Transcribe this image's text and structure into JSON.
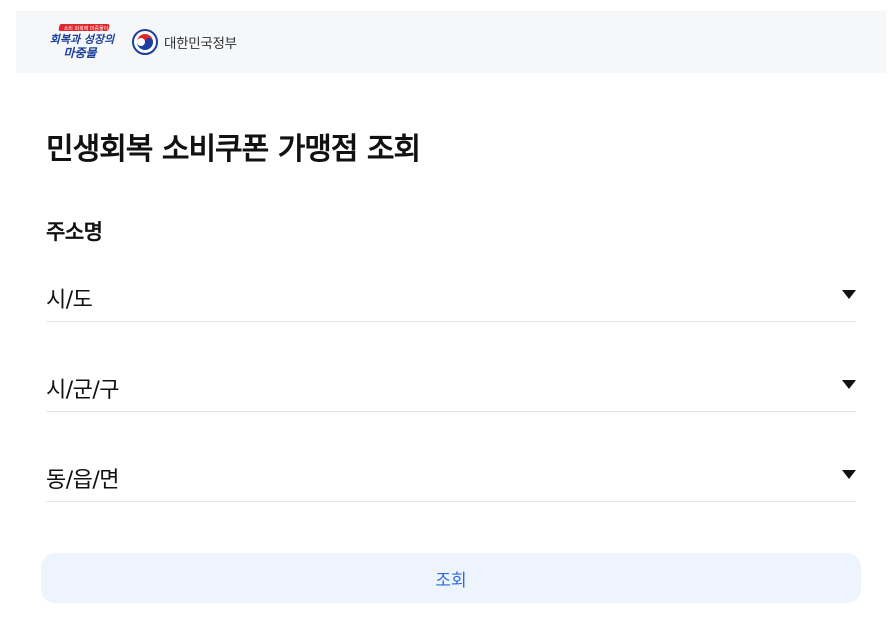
{
  "header": {
    "campaign_logo_text": [
      "회복과 성장의",
      "마중물"
    ],
    "campaign_logo_tag": "소비 회복에 마중물이",
    "gov_name": "대한민국정부"
  },
  "main": {
    "title": "민생회복 소비쿠폰 가맹점 조회",
    "section_label": "주소명",
    "selects": [
      {
        "value": "시/도"
      },
      {
        "value": "시/군/구"
      },
      {
        "value": "동/읍/면"
      }
    ],
    "search_label": "조회"
  },
  "colors": {
    "header_bg": "#f6f7f9",
    "button_bg": "#eef4fd",
    "button_text": "#2f6bd8",
    "logo_blue": "#1c3f9e",
    "logo_red": "#e0252b"
  }
}
